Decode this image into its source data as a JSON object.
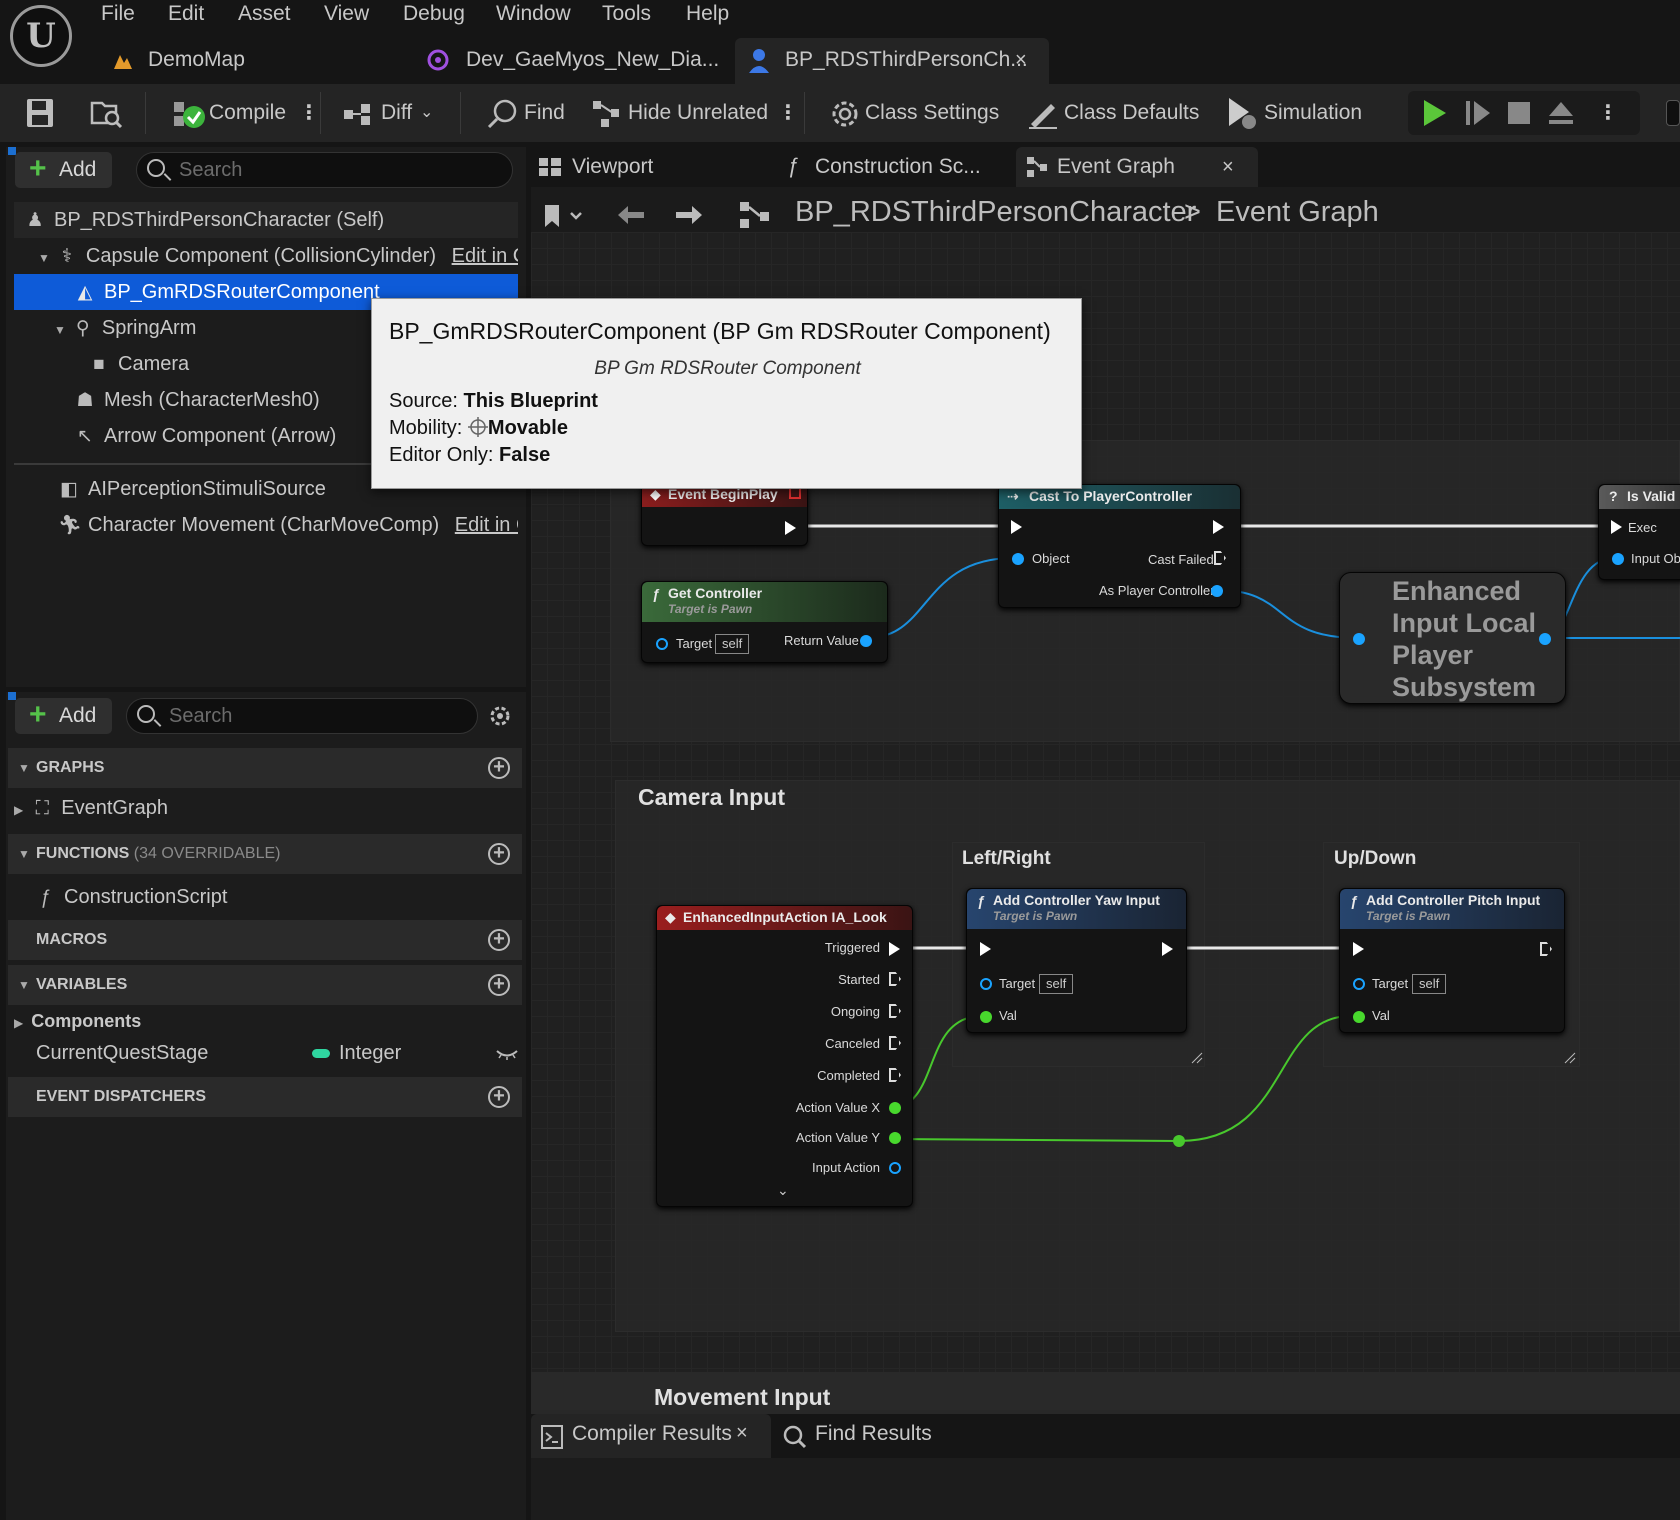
{
  "menu": [
    "File",
    "Edit",
    "Asset",
    "View",
    "Debug",
    "Window",
    "Tools",
    "Help"
  ],
  "doc_tabs": {
    "tab1": "DemoMap",
    "tab2": "Dev_GaeMyos_New_Dia...",
    "tab3": "BP_RDSThirdPersonCh...",
    "close": "×"
  },
  "toolbar": {
    "compile": "Compile",
    "diff": "Diff",
    "find": "Find",
    "hide_unrelated": "Hide Unrelated",
    "class_settings": "Class Settings",
    "class_defaults": "Class Defaults",
    "simulation": "Simulation"
  },
  "components": {
    "add": "Add",
    "search_placeholder": "Search",
    "items": [
      "BP_RDSThirdPersonCharacter (Self)",
      "Capsule Component (CollisionCylinder)",
      "BP_GmRDSRouterComponent",
      "SpringArm",
      "Camera",
      "Mesh (CharacterMesh0)",
      "Arrow Component (Arrow)",
      "AIPerceptionStimuliSource",
      "Character Movement (CharMoveComp)"
    ],
    "edit_in": "Edit in C"
  },
  "my_blueprint": {
    "add": "Add",
    "search_placeholder": "Search",
    "graphs": "GRAPHS",
    "event_graph": "EventGraph",
    "functions": "FUNCTIONS",
    "functions_count": "(34 OVERRIDABLE)",
    "construction_script": "ConstructionScript",
    "macros": "MACROS",
    "variables": "VARIABLES",
    "components_cat": "Components",
    "var_name": "CurrentQuestStage",
    "var_type": "Integer",
    "event_dispatchers": "EVENT DISPATCHERS",
    "var_color": "#2fd6a0"
  },
  "graph_tabs": {
    "viewport": "Viewport",
    "construction": "Construction Sc...",
    "event_graph": "Event Graph",
    "close": "×"
  },
  "breadcrumb": {
    "bp": "BP_RDSThirdPersonCharacter",
    "sep": ">",
    "graph": "Event Graph"
  },
  "tooltip": {
    "title": "BP_GmRDSRouterComponent (BP Gm RDSRouter Component)",
    "subtitle": "BP Gm RDSRouter Component",
    "source_label": "Source:",
    "source_value": "This Blueprint",
    "mobility_label": "Mobility:",
    "mobility_value": "Movable",
    "editor_only_label": "Editor Only:",
    "editor_only_value": "False"
  },
  "nodes": {
    "begin_play": "Event BeginPlay",
    "get_controller": "Get Controller",
    "target_is_pawn": "Target is Pawn",
    "target": "Target",
    "self": "self",
    "return_value": "Return Value",
    "cast": "Cast To PlayerController",
    "object": "Object",
    "cast_failed": "Cast Failed",
    "as_player_controller": "As Player Controller",
    "enhanced_subsystem": "Enhanced Input Local Player Subsystem",
    "is_valid": "Is Valid",
    "exec": "Exec",
    "input_obj": "Input Obj",
    "camera_input": "Camera Input",
    "left_right": "Left/Right",
    "up_down": "Up/Down",
    "ia_look": "EnhancedInputAction IA_Look",
    "triggered": "Triggered",
    "started": "Started",
    "ongoing": "Ongoing",
    "canceled": "Canceled",
    "completed": "Completed",
    "action_value_x": "Action Value X",
    "action_value_y": "Action Value Y",
    "input_action": "Input Action",
    "yaw": "Add Controller Yaw Input",
    "pitch": "Add Controller Pitch Input",
    "val": "Val",
    "movement_input": "Movement Input"
  },
  "bottom_tabs": {
    "compiler_results": "Compiler Results",
    "find_results": "Find Results",
    "close": "×"
  }
}
